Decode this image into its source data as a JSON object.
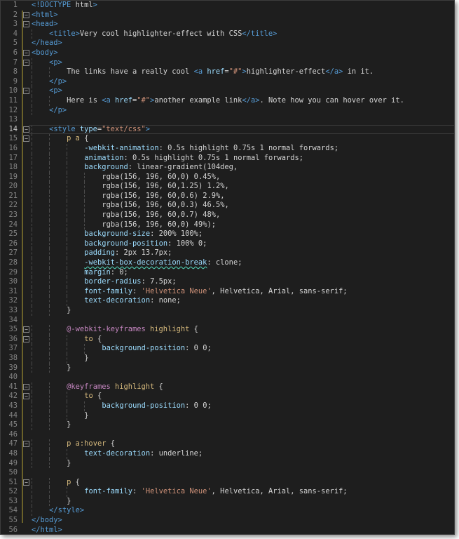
{
  "editor": {
    "current_line": 14,
    "lines": [
      {
        "n": "1",
        "f": "",
        "i": 0,
        "segs": [
          [
            "t",
            "<!DOCTYPE "
          ],
          [
            "w",
            "html"
          ],
          [
            "t",
            ">"
          ]
        ]
      },
      {
        "n": "2",
        "f": "−",
        "i": 0,
        "segs": [
          [
            "t",
            "<html>"
          ]
        ]
      },
      {
        "n": "3",
        "f": "−",
        "i": 0,
        "segs": [
          [
            "t",
            "<head>"
          ]
        ]
      },
      {
        "n": "4",
        "f": "",
        "i": 2,
        "segs": [
          [
            "t",
            "<title>"
          ],
          [
            "w",
            "Very cool highlighter-effect with CSS"
          ],
          [
            "t",
            "</title>"
          ]
        ]
      },
      {
        "n": "5",
        "f": "",
        "i": 0,
        "segs": [
          [
            "t",
            "</head>"
          ]
        ]
      },
      {
        "n": "6",
        "f": "−",
        "i": 0,
        "segs": [
          [
            "t",
            "<body>"
          ]
        ]
      },
      {
        "n": "7",
        "f": "−",
        "i": 2,
        "segs": [
          [
            "t",
            "<p>"
          ]
        ]
      },
      {
        "n": "8",
        "f": "",
        "i": 4,
        "segs": [
          [
            "w",
            "The links have a really cool "
          ],
          [
            "t",
            "<a "
          ],
          [
            "a",
            "href"
          ],
          [
            "w",
            "="
          ],
          [
            "s",
            "\"#\""
          ],
          [
            "t",
            ">"
          ],
          [
            "w",
            "highlighter-effect"
          ],
          [
            "t",
            "</a>"
          ],
          [
            "w",
            " in it."
          ]
        ]
      },
      {
        "n": "9",
        "f": "",
        "i": 2,
        "segs": [
          [
            "t",
            "</p>"
          ]
        ]
      },
      {
        "n": "10",
        "f": "−",
        "i": 2,
        "segs": [
          [
            "t",
            "<p>"
          ]
        ]
      },
      {
        "n": "11",
        "f": "",
        "i": 4,
        "segs": [
          [
            "w",
            "Here is "
          ],
          [
            "t",
            "<a "
          ],
          [
            "a",
            "href"
          ],
          [
            "w",
            "="
          ],
          [
            "s",
            "\"#\""
          ],
          [
            "t",
            ">"
          ],
          [
            "w",
            "another example link"
          ],
          [
            "t",
            "</a>"
          ],
          [
            "w",
            ". Note how you can hover over it."
          ]
        ]
      },
      {
        "n": "12",
        "f": "",
        "i": 2,
        "segs": [
          [
            "t",
            "</p>"
          ]
        ]
      },
      {
        "n": "13",
        "f": "",
        "i": 0,
        "segs": []
      },
      {
        "n": "14",
        "f": "−",
        "i": 2,
        "segs": [
          [
            "t",
            "<style "
          ],
          [
            "a",
            "type"
          ],
          [
            "w",
            "="
          ],
          [
            "s",
            "\"text/css\""
          ],
          [
            "t",
            ">"
          ]
        ]
      },
      {
        "n": "15",
        "f": "−",
        "i": 4,
        "segs": [
          [
            "sel",
            "p a"
          ],
          [
            "w",
            " {"
          ]
        ]
      },
      {
        "n": "16",
        "f": "",
        "i": 6,
        "segs": [
          [
            "p",
            "-webkit-animation"
          ],
          [
            "w",
            ": 0.5s highlight 0.75s 1 normal forwards;"
          ]
        ]
      },
      {
        "n": "17",
        "f": "",
        "i": 6,
        "segs": [
          [
            "p",
            "animation"
          ],
          [
            "w",
            ": 0.5s highlight 0.75s 1 normal forwards;"
          ]
        ]
      },
      {
        "n": "18",
        "f": "",
        "i": 6,
        "segs": [
          [
            "p",
            "background"
          ],
          [
            "w",
            ": linear-gradient(104deg,"
          ]
        ]
      },
      {
        "n": "19",
        "f": "",
        "i": 8,
        "segs": [
          [
            "w",
            "rgba(156, 196, 60,0) 0.45%,"
          ]
        ]
      },
      {
        "n": "20",
        "f": "",
        "i": 8,
        "segs": [
          [
            "w",
            "rgba(156, 196, 60,1.25) 1.2%,"
          ]
        ]
      },
      {
        "n": "21",
        "f": "",
        "i": 8,
        "segs": [
          [
            "w",
            "rgba(156, 196, 60,0.6) 2.9%,"
          ]
        ]
      },
      {
        "n": "22",
        "f": "",
        "i": 8,
        "segs": [
          [
            "w",
            "rgba(156, 196, 60,0.3) 46.5%,"
          ]
        ]
      },
      {
        "n": "23",
        "f": "",
        "i": 8,
        "segs": [
          [
            "w",
            "rgba(156, 196, 60,0.7) 48%,"
          ]
        ]
      },
      {
        "n": "24",
        "f": "",
        "i": 8,
        "segs": [
          [
            "w",
            "rgba(156, 196, 60,0) 49%);"
          ]
        ]
      },
      {
        "n": "25",
        "f": "",
        "i": 6,
        "segs": [
          [
            "p",
            "background-size"
          ],
          [
            "w",
            ": 200% 100%;"
          ]
        ]
      },
      {
        "n": "26",
        "f": "",
        "i": 6,
        "segs": [
          [
            "p",
            "background-position"
          ],
          [
            "w",
            ": 100% 0;"
          ]
        ]
      },
      {
        "n": "27",
        "f": "",
        "i": 6,
        "segs": [
          [
            "p",
            "padding"
          ],
          [
            "w",
            ": 2px 13.7px;"
          ]
        ]
      },
      {
        "n": "28",
        "f": "",
        "i": 6,
        "segs": [
          [
            "psq",
            "-webkit-box-decoration-break"
          ],
          [
            "w",
            ": clone;"
          ]
        ]
      },
      {
        "n": "29",
        "f": "",
        "i": 6,
        "segs": [
          [
            "p",
            "margin"
          ],
          [
            "w",
            ": 0;"
          ]
        ]
      },
      {
        "n": "30",
        "f": "",
        "i": 6,
        "segs": [
          [
            "p",
            "border-radius"
          ],
          [
            "w",
            ": 7.5px;"
          ]
        ]
      },
      {
        "n": "31",
        "f": "",
        "i": 6,
        "segs": [
          [
            "p",
            "font-family"
          ],
          [
            "w",
            ": "
          ],
          [
            "s",
            "'Helvetica Neue'"
          ],
          [
            "w",
            ", Helvetica, Arial, sans-serif;"
          ]
        ]
      },
      {
        "n": "32",
        "f": "",
        "i": 6,
        "segs": [
          [
            "p",
            "text-decoration"
          ],
          [
            "w",
            ": none;"
          ]
        ]
      },
      {
        "n": "33",
        "f": "",
        "i": 4,
        "segs": [
          [
            "w",
            "}"
          ]
        ]
      },
      {
        "n": "34",
        "f": "",
        "i": 0,
        "segs": []
      },
      {
        "n": "35",
        "f": "−",
        "i": 4,
        "segs": [
          [
            "k",
            "@-webkit-keyframes"
          ],
          [
            "w",
            " "
          ],
          [
            "sel",
            "highlight"
          ],
          [
            "w",
            " {"
          ]
        ]
      },
      {
        "n": "36",
        "f": "−",
        "i": 6,
        "segs": [
          [
            "sel",
            "to"
          ],
          [
            "w",
            " {"
          ]
        ]
      },
      {
        "n": "37",
        "f": "",
        "i": 8,
        "segs": [
          [
            "p",
            "background-position"
          ],
          [
            "w",
            ": 0 0;"
          ]
        ]
      },
      {
        "n": "38",
        "f": "",
        "i": 6,
        "segs": [
          [
            "w",
            "}"
          ]
        ]
      },
      {
        "n": "39",
        "f": "",
        "i": 4,
        "segs": [
          [
            "w",
            "}"
          ]
        ]
      },
      {
        "n": "40",
        "f": "",
        "i": 0,
        "segs": []
      },
      {
        "n": "41",
        "f": "−",
        "i": 4,
        "segs": [
          [
            "k",
            "@keyframes"
          ],
          [
            "w",
            " "
          ],
          [
            "sel",
            "highlight"
          ],
          [
            "w",
            " {"
          ]
        ]
      },
      {
        "n": "42",
        "f": "−",
        "i": 6,
        "segs": [
          [
            "sel",
            "to"
          ],
          [
            "w",
            " {"
          ]
        ]
      },
      {
        "n": "43",
        "f": "",
        "i": 8,
        "segs": [
          [
            "p",
            "background-position"
          ],
          [
            "w",
            ": 0 0;"
          ]
        ]
      },
      {
        "n": "44",
        "f": "",
        "i": 6,
        "segs": [
          [
            "w",
            "}"
          ]
        ]
      },
      {
        "n": "45",
        "f": "",
        "i": 4,
        "segs": [
          [
            "w",
            "}"
          ]
        ]
      },
      {
        "n": "46",
        "f": "",
        "i": 0,
        "segs": []
      },
      {
        "n": "47",
        "f": "−",
        "i": 4,
        "segs": [
          [
            "sel",
            "p a:hover"
          ],
          [
            "w",
            " {"
          ]
        ]
      },
      {
        "n": "48",
        "f": "",
        "i": 6,
        "segs": [
          [
            "p",
            "text-decoration"
          ],
          [
            "w",
            ": underline;"
          ]
        ]
      },
      {
        "n": "49",
        "f": "",
        "i": 4,
        "segs": [
          [
            "w",
            "}"
          ]
        ]
      },
      {
        "n": "50",
        "f": "",
        "i": 0,
        "segs": []
      },
      {
        "n": "51",
        "f": "−",
        "i": 4,
        "segs": [
          [
            "sel",
            "p"
          ],
          [
            "w",
            " {"
          ]
        ]
      },
      {
        "n": "52",
        "f": "",
        "i": 6,
        "segs": [
          [
            "p",
            "font-family"
          ],
          [
            "w",
            ": "
          ],
          [
            "s",
            "'Helvetica Neue'"
          ],
          [
            "w",
            ", Helvetica, Arial, sans-serif;"
          ]
        ]
      },
      {
        "n": "53",
        "f": "",
        "i": 4,
        "segs": [
          [
            "w",
            "}"
          ]
        ]
      },
      {
        "n": "54",
        "f": "",
        "i": 2,
        "segs": [
          [
            "t",
            "</style>"
          ]
        ]
      },
      {
        "n": "55",
        "f": "",
        "i": 0,
        "segs": [
          [
            "t",
            "</body>"
          ]
        ]
      },
      {
        "n": "56",
        "f": "",
        "i": 0,
        "segs": [
          [
            "t",
            "</html>"
          ]
        ]
      }
    ]
  }
}
